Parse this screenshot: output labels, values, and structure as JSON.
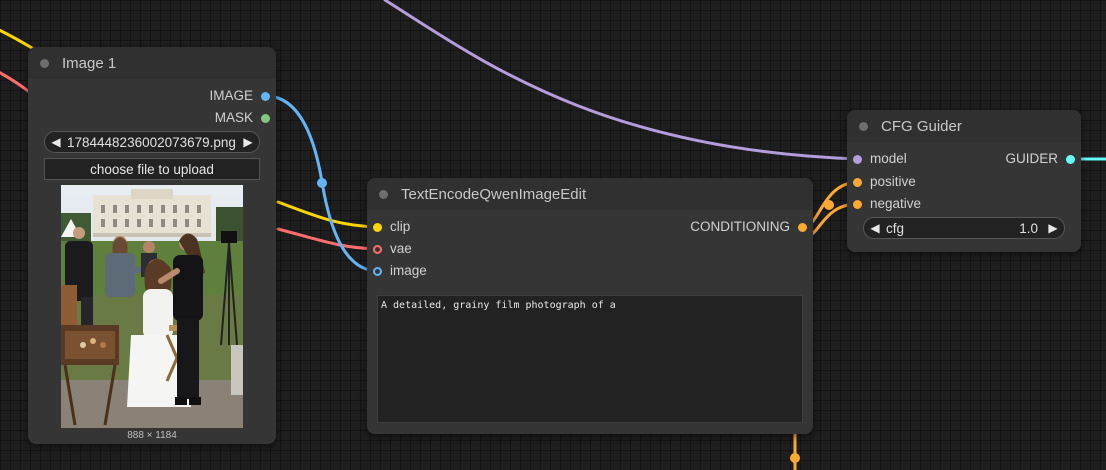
{
  "nodes": {
    "image_loader": {
      "title": "Image 1",
      "outputs": [
        {
          "label": "IMAGE",
          "color": "#64b5f6"
        },
        {
          "label": "MASK",
          "color": "#81c784"
        }
      ],
      "filename": "1784448236002073679.png",
      "upload_label": "choose file to upload",
      "dimensions": "888 × 1184"
    },
    "text_encode": {
      "title": "TextEncodeQwenImageEdit",
      "inputs": [
        {
          "label": "clip",
          "color": "#ffd500",
          "hollow": false
        },
        {
          "label": "vae",
          "color": "#ff6e6e",
          "hollow": true
        },
        {
          "label": "image",
          "color": "#64b5f6",
          "hollow": true
        }
      ],
      "output": {
        "label": "CONDITIONING",
        "color": "#ffa931"
      },
      "prompt": "A detailed, grainy film photograph of a"
    },
    "cfg_guider": {
      "title": "CFG Guider",
      "inputs": [
        {
          "label": "model",
          "color": "#b39ddb"
        },
        {
          "label": "positive",
          "color": "#ffa931"
        },
        {
          "label": "negative",
          "color": "#ffa931"
        }
      ],
      "output": {
        "label": "GUIDER",
        "color": "#66ffff"
      },
      "cfg_label": "cfg",
      "cfg_value": "1.0"
    }
  },
  "colors": {
    "model_wire": "#b39ddb",
    "clip_wire": "#ffd500",
    "vae_wire": "#ff6e6e",
    "image_wire": "#64b5f6",
    "conditioning_wire": "#ffa931",
    "guider_wire": "#66ffff"
  }
}
